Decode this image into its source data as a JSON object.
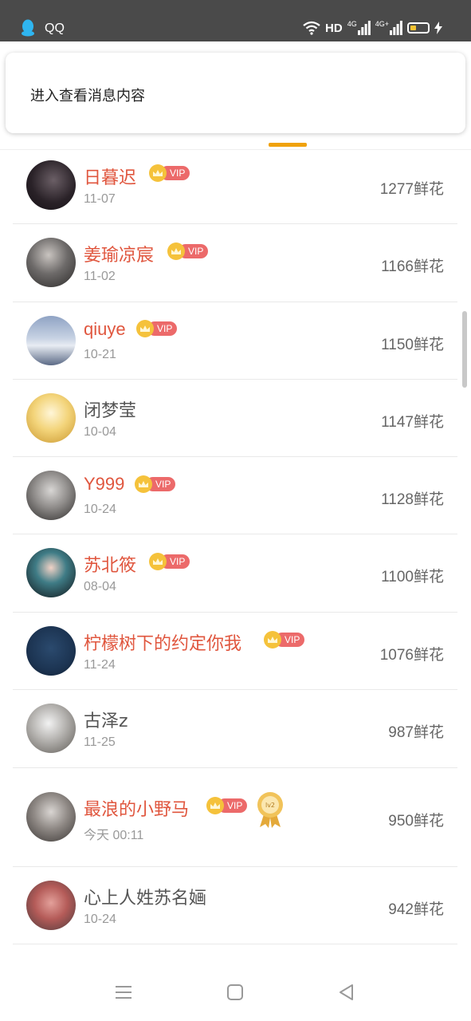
{
  "status_bar": {
    "app_label": "QQ",
    "network_quality": "HD",
    "network_1": "4G",
    "network_2": "4G+",
    "battery_level": 0.25,
    "icons": [
      "qq-penguin-icon",
      "wifi-icon",
      "signal-icon",
      "battery-icon",
      "charging-bolt-icon"
    ]
  },
  "notification": {
    "text": "进入查看消息内容"
  },
  "colors": {
    "accent": "#f0a20e",
    "vip_name": "#e0563e",
    "vip_pill": "#ec6a6a",
    "crown": "#f5c23b"
  },
  "list": [
    {
      "name": "日暮迟",
      "vip": true,
      "date": "11-07",
      "flowers": "1277鲜花"
    },
    {
      "name": "姜瑜凉宸",
      "vip": true,
      "date": "11-02",
      "flowers": "1166鲜花"
    },
    {
      "name": "qiuye",
      "vip": true,
      "date": "10-21",
      "flowers": "1150鲜花"
    },
    {
      "name": "闭梦莹",
      "vip": false,
      "date": "10-04",
      "flowers": "1147鲜花"
    },
    {
      "name": "Y999",
      "vip": true,
      "date": "10-24",
      "flowers": "1128鲜花"
    },
    {
      "name": "苏北筱",
      "vip": true,
      "date": "08-04",
      "flowers": "1100鲜花"
    },
    {
      "name": "柠檬树下的约定你我",
      "vip": true,
      "date": "11-24",
      "flowers": "1076鲜花"
    },
    {
      "name": "古泽z",
      "vip": false,
      "date": "11-25",
      "flowers": "987鲜花"
    },
    {
      "name": "最浪的小野马",
      "vip": true,
      "level_medal": "lv2",
      "date": "今天 00:11",
      "flowers": "950鲜花"
    },
    {
      "name": "心上人姓苏名婳",
      "vip": false,
      "date": "10-24",
      "flowers": "942鲜花"
    }
  ],
  "vip_label": "VIP",
  "nav_bar": {
    "icons": [
      "menu-icon",
      "home-icon",
      "back-icon"
    ]
  }
}
